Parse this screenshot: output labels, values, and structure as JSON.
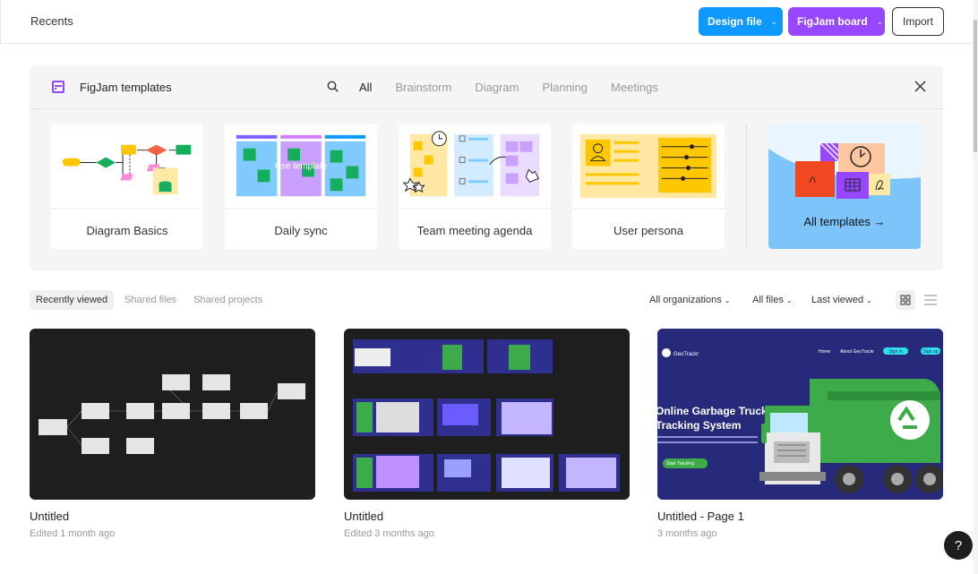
{
  "header": {
    "title": "Recents",
    "design_file_label": "Design file",
    "figjam_board_label": "FigJam board",
    "import_label": "Import"
  },
  "templates": {
    "title": "FigJam templates",
    "filters": [
      "All",
      "Brainstorm",
      "Diagram",
      "Planning",
      "Meetings"
    ],
    "active_filter": "All",
    "cards": [
      {
        "label": "Diagram Basics"
      },
      {
        "label": "Daily sync",
        "hover_text": "Use template"
      },
      {
        "label": "Team meeting agenda"
      },
      {
        "label": "User persona"
      }
    ],
    "all_templates_label": "All templates →"
  },
  "files_tabs": [
    "Recently viewed",
    "Shared files",
    "Shared projects"
  ],
  "file_filters": {
    "organizations": "All organizations",
    "files": "All files",
    "sort": "Last viewed"
  },
  "files": [
    {
      "name": "Untitled",
      "meta": "Edited 1 month ago"
    },
    {
      "name": "Untitled",
      "meta": "Edited 3 months ago"
    },
    {
      "name": "Untitled - Page 1",
      "meta": "3 months ago",
      "preview": {
        "brand": "GeoTrackr",
        "nav": [
          "Home",
          "About GeoTrackr"
        ],
        "signin": "Sign in",
        "signup": "Sign up",
        "headline_1": "Online Garbage Truck",
        "headline_2": "Tracking System",
        "cta": "Start Tracking"
      }
    }
  ],
  "help_label": "?",
  "colors": {
    "design_blue": "#0d99ff",
    "figjam_purple": "#9747ff",
    "all_templates_blue": "#7cc4fa",
    "dark_thumb": "#1e1e1e",
    "geo_navy": "#272a7a",
    "truck_green": "#3dab4a"
  }
}
